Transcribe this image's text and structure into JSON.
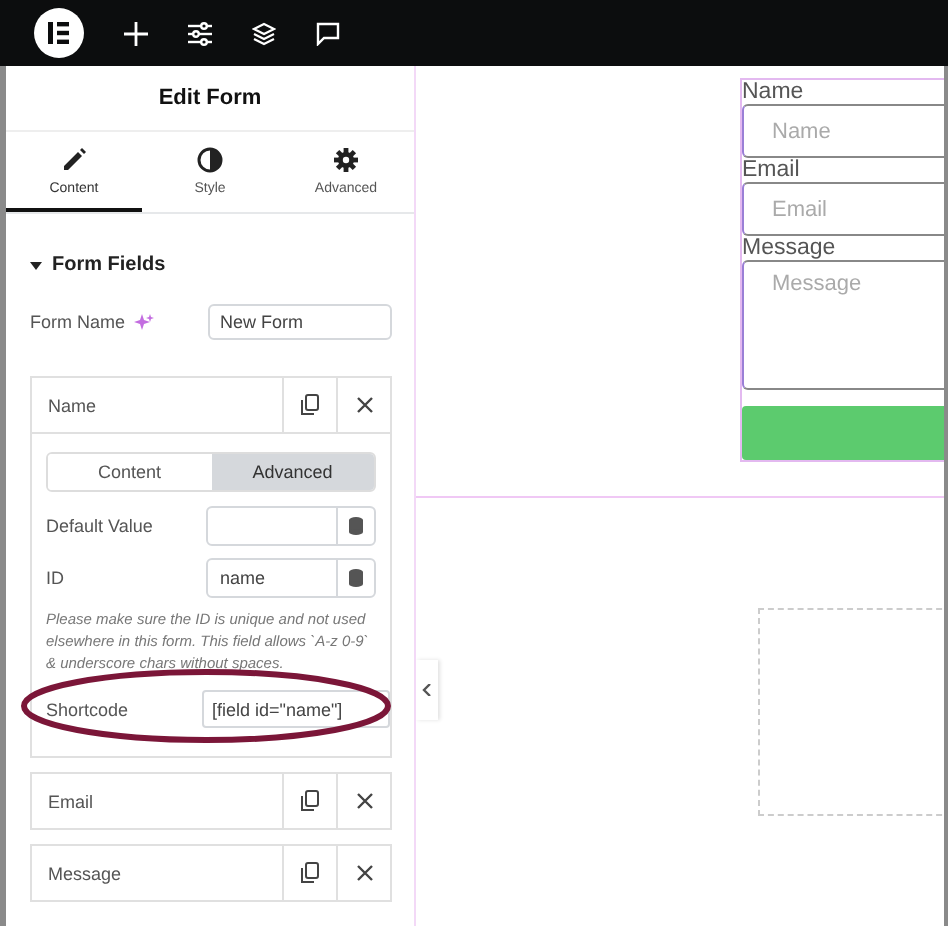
{
  "panel": {
    "title": "Edit Form",
    "tabs": [
      {
        "label": "Content",
        "selected": true
      },
      {
        "label": "Style",
        "selected": false
      },
      {
        "label": "Advanced",
        "selected": false
      }
    ],
    "section": {
      "title": "Form Fields",
      "expanded": true
    },
    "form_name": {
      "label": "Form Name",
      "value": "New Form"
    },
    "fields": [
      {
        "label": "Name",
        "expanded": true,
        "subtabs": [
          {
            "label": "Content",
            "selected": false
          },
          {
            "label": "Advanced",
            "selected": true
          }
        ],
        "controls": [
          {
            "kind": "input",
            "label": "Default Value"
          },
          {
            "kind": "input",
            "label": "ID",
            "value": "name"
          },
          {
            "kind": "help",
            "text": "Please make sure the ID is unique and not used elsewhere in this form. This field allows `A-z 0-9` & underscore chars without spaces."
          },
          {
            "kind": "shortcode",
            "label": "Shortcode",
            "value": "[field id=\"name\"]",
            "highlighted": true
          }
        ]
      },
      {
        "label": "Email",
        "expanded": false
      },
      {
        "label": "Message",
        "expanded": false
      }
    ]
  },
  "canvas": {
    "form": [
      {
        "kind": "input",
        "label": "Name",
        "placeholder": "Name"
      },
      {
        "kind": "input",
        "label": "Email",
        "placeholder": "Email"
      },
      {
        "kind": "textarea",
        "label": "Message",
        "placeholder": "Message"
      }
    ]
  }
}
